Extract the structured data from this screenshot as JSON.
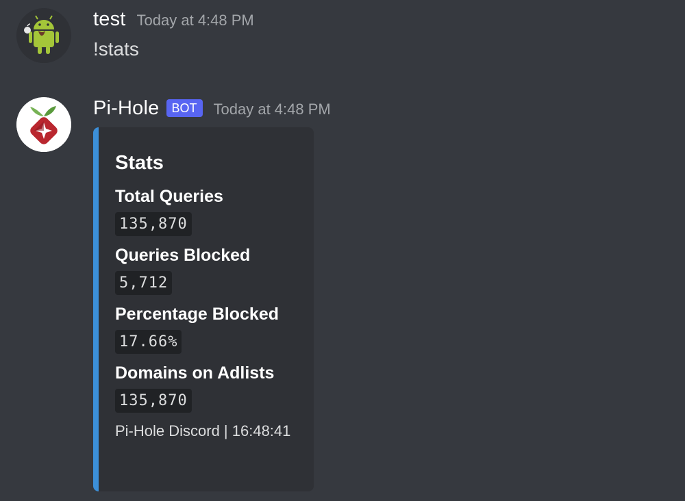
{
  "messages": [
    {
      "username": "test",
      "timestamp": "Today at 4:48 PM",
      "content": "!stats",
      "avatar_icon": "android-robot-icon"
    },
    {
      "username": "Pi-Hole",
      "bot_tag": "BOT",
      "timestamp": "Today at 4:48 PM",
      "avatar_icon": "pi-hole-logo-icon",
      "embed": {
        "accent_color": "#3c8fd8",
        "title": "Stats",
        "fields": [
          {
            "name": "Total Queries",
            "value": "135,870"
          },
          {
            "name": "Queries Blocked",
            "value": "5,712"
          },
          {
            "name": "Percentage Blocked",
            "value": "17.66%"
          },
          {
            "name": "Domains on Adlists",
            "value": "135,870"
          }
        ],
        "footer": "Pi-Hole Discord | 16:48:41"
      }
    }
  ],
  "colors": {
    "background": "#36393f",
    "embed_background": "#2f3136",
    "bot_tag": "#5865f2"
  }
}
